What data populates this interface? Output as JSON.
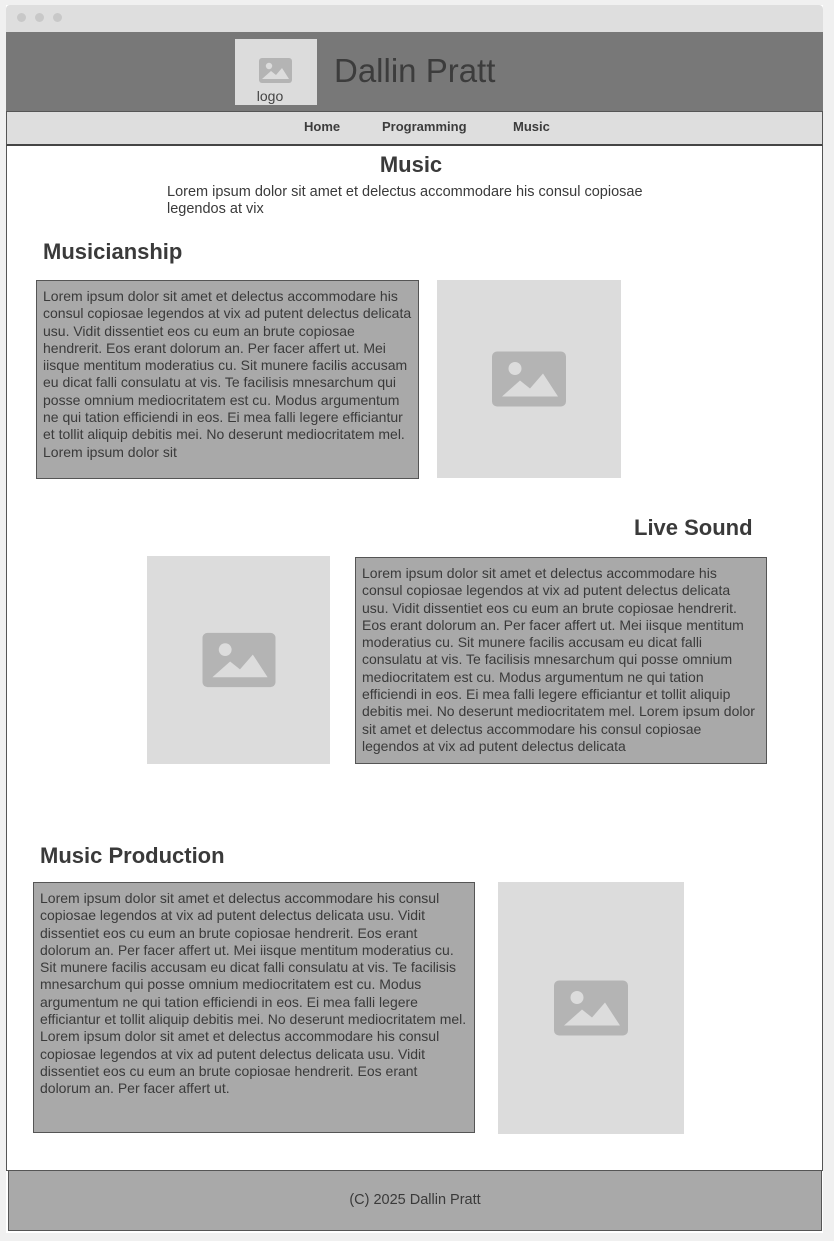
{
  "header": {
    "logo_label": "logo",
    "site_title": "Dallin Pratt"
  },
  "nav": {
    "items": [
      {
        "label": "Home"
      },
      {
        "label": "Programming"
      },
      {
        "label": "Music"
      }
    ]
  },
  "page": {
    "title": "Music",
    "intro": "Lorem ipsum dolor sit amet et delectus accommodare his consul copiosae legendos at vix"
  },
  "sections": [
    {
      "heading": "Musicianship",
      "text": "Lorem ipsum dolor sit amet et delectus accommodare his consul copiosae legendos at vix ad putent delectus delicata usu. Vidit dissentiet eos cu eum an brute copiosae hendrerit. Eos erant dolorum an. Per facer affert ut. Mei iisque mentitum moderatius cu. Sit munere facilis accusam eu dicat falli consulatu at vis. Te facilisis mnesarchum qui posse omnium mediocritatem est cu. Modus argumentum ne qui tation efficiendi in eos. Ei mea falli legere efficiantur et tollit aliquip debitis mei. No deserunt mediocritatem mel. Lorem ipsum dolor sit",
      "image_icon": "image-placeholder-icon"
    },
    {
      "heading": "Live Sound",
      "text": "Lorem ipsum dolor sit amet et delectus accommodare his consul copiosae legendos at vix ad putent delectus delicata usu. Vidit dissentiet eos cu eum an brute copiosae hendrerit. Eos erant dolorum an. Per facer affert ut. Mei iisque mentitum moderatius cu. Sit munere facilis accusam eu dicat falli consulatu at vis. Te facilisis mnesarchum qui posse omnium mediocritatem est cu. Modus argumentum ne qui tation efficiendi in eos. Ei mea falli legere efficiantur et tollit aliquip debitis mei. No deserunt mediocritatem mel. Lorem ipsum dolor sit amet et delectus accommodare his consul copiosae legendos at vix ad putent delectus delicata",
      "image_icon": "image-placeholder-icon"
    },
    {
      "heading": "Music Production",
      "text": "Lorem ipsum dolor sit amet et delectus accommodare his consul copiosae legendos at vix ad putent delectus delicata usu. Vidit dissentiet eos cu eum an brute copiosae hendrerit. Eos erant dolorum an. Per facer affert ut. Mei iisque mentitum moderatius cu. Sit munere facilis accusam eu dicat falli consulatu at vis. Te facilisis mnesarchum qui posse omnium mediocritatem est cu. Modus argumentum ne qui tation efficiendi in eos. Ei mea falli legere efficiantur et tollit aliquip debitis mei. No deserunt mediocritatem mel. Lorem ipsum dolor sit amet et delectus accommodare his consul copiosae legendos at vix ad putent delectus delicata usu. Vidit dissentiet eos cu eum an brute copiosae hendrerit. Eos erant dolorum an. Per facer affert ut.",
      "image_icon": "image-placeholder-icon"
    }
  ],
  "footer": {
    "text": "(C) 2025 Dallin Pratt"
  },
  "colors": {
    "header_bg": "#787878",
    "nav_bg": "#dedede",
    "textbox_bg": "#a9a9a9",
    "image_placeholder_bg": "#dcdcdc",
    "icon_color": "#b4b4b4"
  }
}
